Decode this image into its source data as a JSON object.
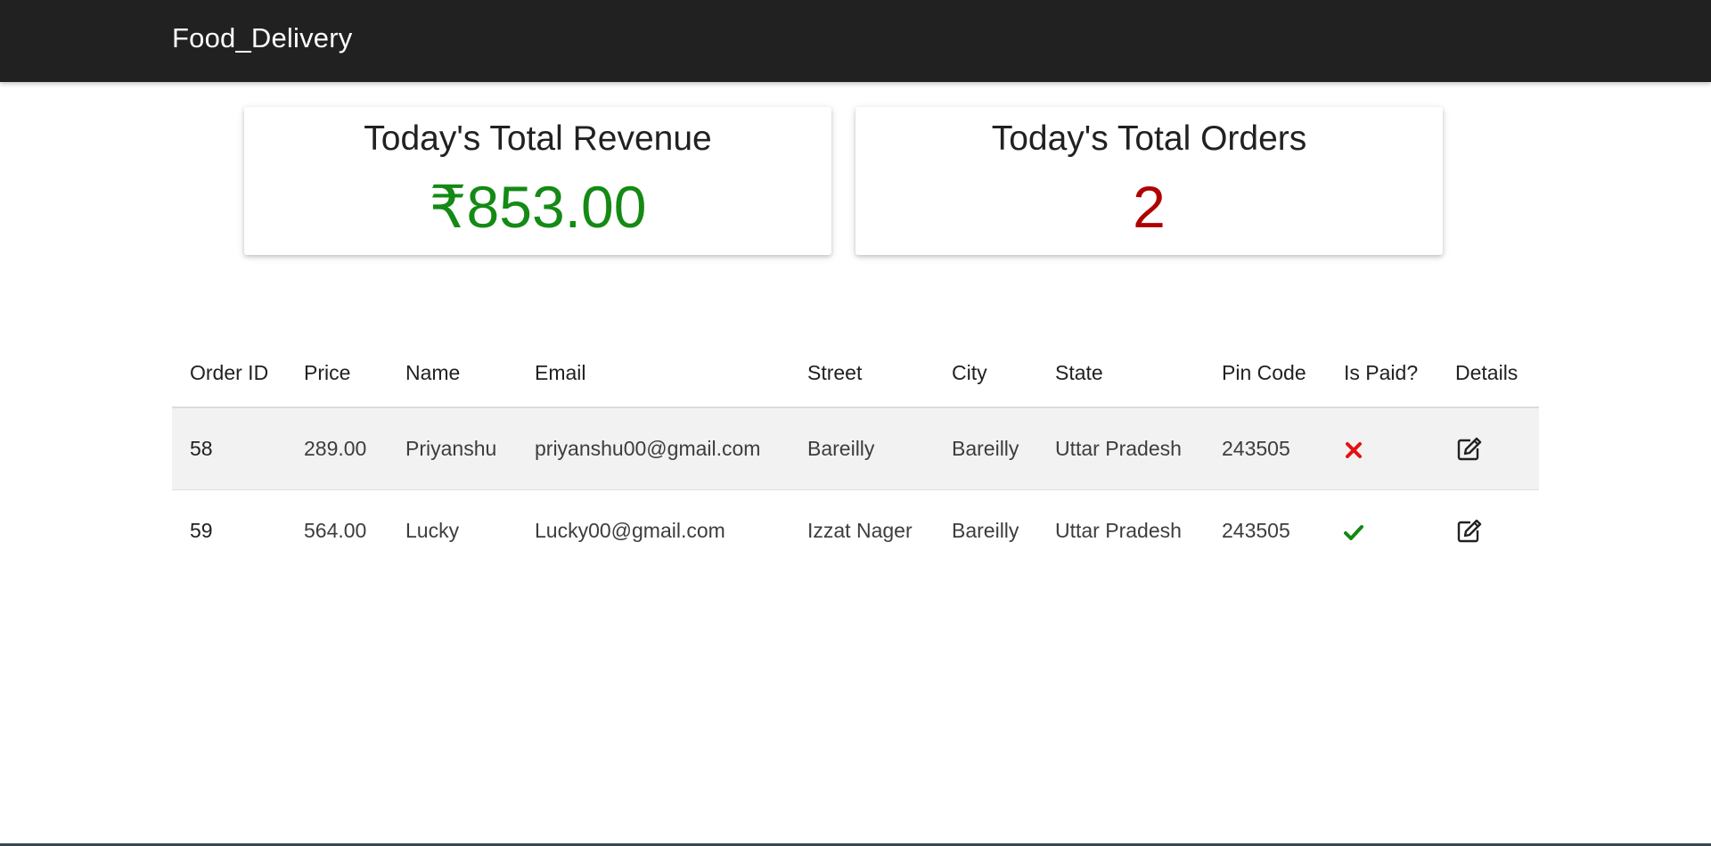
{
  "navbar": {
    "brand": "Food_Delivery"
  },
  "cards": {
    "revenue": {
      "title": "Today's Total Revenue",
      "value": "₹853.00",
      "color": "#148a14"
    },
    "orders": {
      "title": "Today's Total Orders",
      "value": "2",
      "color": "#b00000"
    }
  },
  "table": {
    "headers": [
      "Order ID",
      "Price",
      "Name",
      "Email",
      "Street",
      "City",
      "State",
      "Pin Code",
      "Is Paid?",
      "Details"
    ],
    "rows": [
      {
        "order_id": "58",
        "price": "289.00",
        "name": "Priyanshu",
        "email": "priyanshu00@gmail.com",
        "street": "Bareilly",
        "city": "Bareilly",
        "state": "Uttar Pradesh",
        "pin": "243505",
        "paid_icon": "x-mark-icon",
        "paid": false,
        "details_icon": "edit-icon"
      },
      {
        "order_id": "59",
        "price": "564.00",
        "name": "Lucky",
        "email": "Lucky00@gmail.com",
        "street": "Izzat Nager",
        "city": "Bareilly",
        "state": "Uttar Pradesh",
        "pin": "243505",
        "paid_icon": "check-mark-icon",
        "paid": true,
        "details_icon": "edit-icon"
      }
    ]
  },
  "colors": {
    "navbar_bg": "#212121",
    "unpaid": "#e31313",
    "paid": "#118a11",
    "row_shade": "#f2f2f2"
  }
}
